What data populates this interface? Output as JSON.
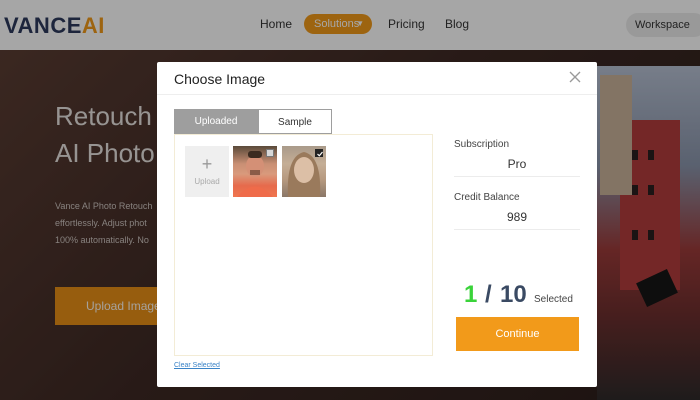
{
  "nav": {
    "logo_main": "VANCE",
    "logo_accent": "AI",
    "links": [
      "Home",
      "Pricing",
      "Blog"
    ],
    "solutions_label": "Solutions",
    "workspace_label": "Workspace",
    "accent_color": "#f29a1a"
  },
  "hero": {
    "title_line1": "Retouch",
    "title_line2": "AI Photo",
    "desc_lines": [
      "Vance AI Photo Retouch",
      "effortlessly. Adjust phot",
      "100% automatically. No"
    ],
    "upload_label": "Upload Image"
  },
  "modal": {
    "title": "Choose Image",
    "close_icon": "close-icon",
    "tabs": [
      "Uploaded",
      "Sample"
    ],
    "active_tab": "Uploaded",
    "upload_tile_plus": "+",
    "upload_tile_label": "Upload",
    "thumbnails": [
      {
        "selected": false
      },
      {
        "selected": true
      }
    ],
    "clear_selected": "Clear Selected",
    "subscription_label": "Subscription",
    "subscription_value": "Pro",
    "credit_label": "Credit Balance",
    "credit_value": "989",
    "selected_count": "1",
    "slash": "/",
    "max_count": "10",
    "selected_label": "Selected",
    "continue_label": "Continue",
    "selected_color": "#3ad33a"
  }
}
